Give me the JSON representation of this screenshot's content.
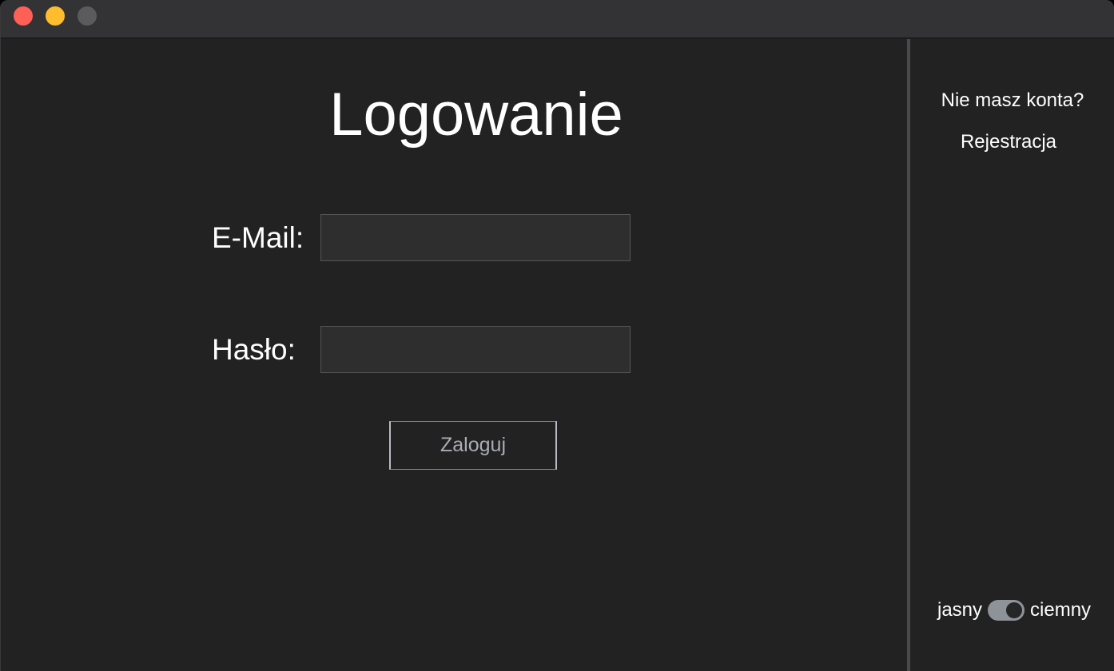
{
  "window": {
    "controls": [
      "close",
      "minimize",
      "zoom"
    ]
  },
  "login": {
    "title": "Logowanie",
    "email_label": "E-Mail:",
    "email_value": "",
    "password_label": "Hasło:",
    "password_value": "",
    "submit_label": "Zaloguj"
  },
  "sidebar": {
    "no_account_text": "Nie masz konta?",
    "register_label": "Rejestracja",
    "theme": {
      "light_label": "jasny",
      "dark_label": "ciemny",
      "dark_enabled": true
    }
  },
  "colors": {
    "background": "#222222",
    "titlebar": "#333335",
    "close": "#fe5f57",
    "minimize": "#febc2e",
    "zoom": "#5b5b5e",
    "text": "#ffffff",
    "button_text": "#a9adb3",
    "toggle_track": "#8e939a"
  }
}
